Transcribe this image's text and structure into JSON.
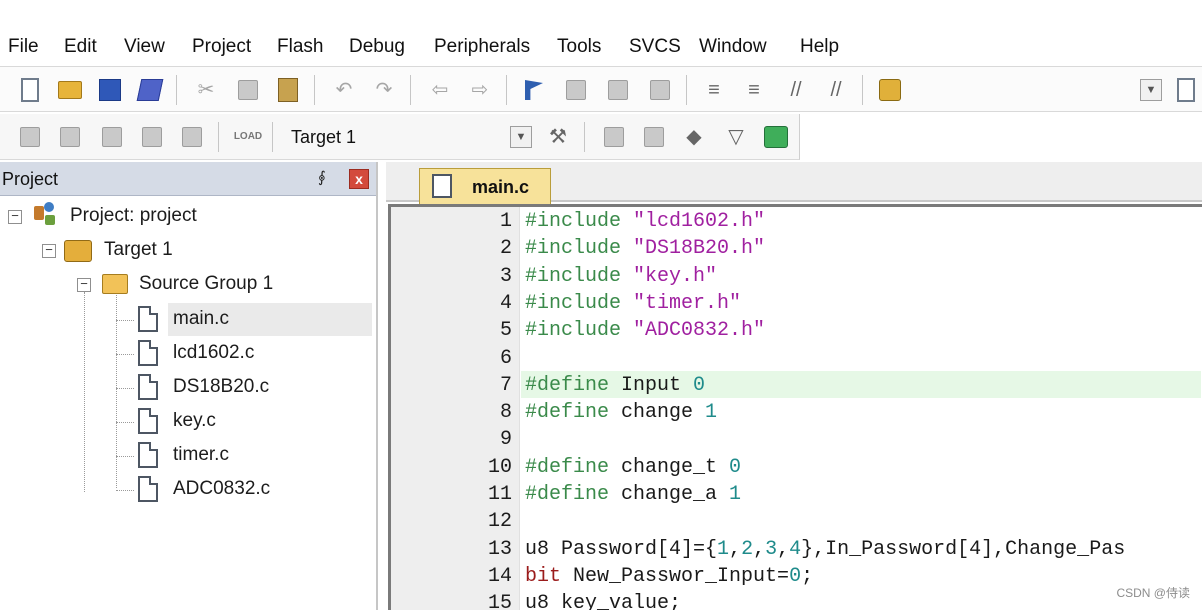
{
  "menu": [
    "File",
    "Edit",
    "View",
    "Project",
    "Flash",
    "Debug",
    "Peripherals",
    "Tools",
    "SVCS",
    "Window",
    "Help"
  ],
  "toolbar2": {
    "target_combo_value": "Target 1",
    "load_icon_text": "LOAD"
  },
  "project_panel": {
    "title": "Project",
    "pin_glyph": "⨕",
    "close_glyph": "x",
    "tree": {
      "root": "Project: project",
      "target": "Target 1",
      "group": "Source Group 1",
      "files": [
        "main.c",
        "lcd1602.c",
        "DS18B20.c",
        "key.c",
        "timer.c",
        "ADC0832.c"
      ],
      "selected_file": "main.c"
    }
  },
  "editor": {
    "active_tab": "main.c",
    "highlighted_line": 7,
    "lines": [
      {
        "n": "1",
        "tokens": [
          [
            "p",
            "#include "
          ],
          [
            "s",
            "\"lcd1602.h\""
          ]
        ]
      },
      {
        "n": "2",
        "tokens": [
          [
            "p",
            "#include "
          ],
          [
            "s",
            "\"DS18B20.h\""
          ]
        ]
      },
      {
        "n": "3",
        "tokens": [
          [
            "p",
            "#include "
          ],
          [
            "s",
            "\"key.h\""
          ]
        ]
      },
      {
        "n": "4",
        "tokens": [
          [
            "p",
            "#include "
          ],
          [
            "s",
            "\"timer.h\""
          ]
        ]
      },
      {
        "n": "5",
        "tokens": [
          [
            "p",
            "#include "
          ],
          [
            "s",
            "\"ADC0832.h\""
          ]
        ]
      },
      {
        "n": "6",
        "tokens": []
      },
      {
        "n": "7",
        "tokens": [
          [
            "p",
            "#define "
          ],
          [
            "t",
            "Input "
          ],
          [
            "n",
            "0"
          ]
        ]
      },
      {
        "n": "8",
        "tokens": [
          [
            "p",
            "#define "
          ],
          [
            "t",
            "change "
          ],
          [
            "n",
            "1"
          ]
        ]
      },
      {
        "n": "9",
        "tokens": []
      },
      {
        "n": "10",
        "tokens": [
          [
            "p",
            "#define "
          ],
          [
            "t",
            "change_t "
          ],
          [
            "n",
            "0"
          ]
        ]
      },
      {
        "n": "11",
        "tokens": [
          [
            "p",
            "#define "
          ],
          [
            "t",
            "change_a "
          ],
          [
            "n",
            "1"
          ]
        ]
      },
      {
        "n": "12",
        "tokens": []
      },
      {
        "n": "13",
        "tokens": [
          [
            "t",
            "u8 Password[4]={"
          ],
          [
            "n",
            "1"
          ],
          [
            "t",
            ","
          ],
          [
            "n",
            "2"
          ],
          [
            "t",
            ","
          ],
          [
            "n",
            "3"
          ],
          [
            "t",
            ","
          ],
          [
            "n",
            "4"
          ],
          [
            "t",
            "},In_Password[4],Change_Pas"
          ]
        ]
      },
      {
        "n": "14",
        "tokens": [
          [
            "k",
            "bit"
          ],
          [
            "t",
            " New_Passwor_Input="
          ],
          [
            "n",
            "0"
          ],
          [
            "t",
            ";"
          ]
        ]
      },
      {
        "n": "15",
        "tokens": [
          [
            "t",
            "u8 key_value;"
          ]
        ]
      }
    ]
  },
  "watermark": "CSDN @侍读",
  "colors": {
    "preprocessor": "#3a8a4a",
    "string": "#a020a0",
    "number": "#1f8b8b",
    "keyword": "#9b1c1c",
    "line_highlight": "#e6f8e6",
    "tab": "#f7e29a"
  }
}
